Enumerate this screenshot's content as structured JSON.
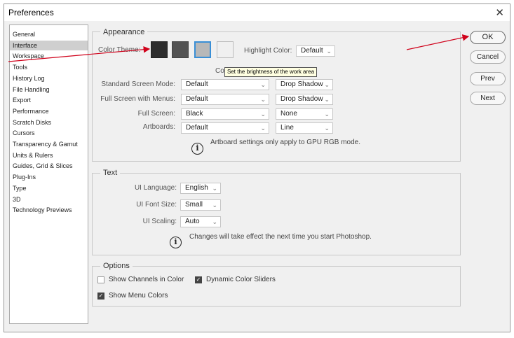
{
  "window": {
    "title": "Preferences",
    "close_glyph": "✕"
  },
  "sidebar": {
    "items": [
      {
        "label": "General"
      },
      {
        "label": "Interface",
        "selected": true
      },
      {
        "label": "Workspace"
      },
      {
        "label": "Tools"
      },
      {
        "label": "History Log"
      },
      {
        "label": "File Handling"
      },
      {
        "label": "Export"
      },
      {
        "label": "Performance"
      },
      {
        "label": "Scratch Disks"
      },
      {
        "label": "Cursors"
      },
      {
        "label": "Transparency & Gamut"
      },
      {
        "label": "Units & Rulers"
      },
      {
        "label": "Guides, Grid & Slices"
      },
      {
        "label": "Plug-Ins"
      },
      {
        "label": "Type"
      },
      {
        "label": "3D"
      },
      {
        "label": "Technology Previews"
      }
    ]
  },
  "appearance": {
    "legend": "Appearance",
    "color_theme_label": "Color Theme:",
    "swatches": [
      {
        "name": "theme-darkest",
        "color": "#2d2d2d"
      },
      {
        "name": "theme-dark",
        "color": "#535353"
      },
      {
        "name": "theme-light",
        "color": "#b8b8b8"
      },
      {
        "name": "theme-lightest",
        "color": "#f0f0f0"
      }
    ],
    "highlight_label": "Highlight Color:",
    "highlight_value": "Default",
    "hidden_label_fragment": "Col",
    "tooltip": "Set the brightness of the work area",
    "rows": [
      {
        "label": "Standard Screen Mode:",
        "mode": "Default",
        "border": "Drop Shadow"
      },
      {
        "label": "Full Screen with Menus:",
        "mode": "Default",
        "border": "Drop Shadow"
      },
      {
        "label": "Full Screen:",
        "mode": "Black",
        "border": "None"
      },
      {
        "label": "Artboards:",
        "mode": "Default",
        "border": "Line"
      }
    ],
    "note": "Artboard settings only apply to GPU RGB mode."
  },
  "text_section": {
    "legend": "Text",
    "ui_language_label": "UI Language:",
    "ui_language": "English",
    "ui_font_size_label": "UI Font Size:",
    "ui_font_size": "Small",
    "ui_scaling_label": "UI Scaling:",
    "ui_scaling": "Auto",
    "note": "Changes will take effect the next time you start Photoshop."
  },
  "options": {
    "legend": "Options",
    "show_channels": {
      "label": "Show Channels in Color",
      "checked": false
    },
    "dynamic_sliders": {
      "label": "Dynamic Color Sliders",
      "checked": true
    },
    "show_menu_colors": {
      "label": "Show Menu Colors",
      "checked": true
    }
  },
  "buttons": {
    "ok": "OK",
    "cancel": "Cancel",
    "prev": "Prev",
    "next": "Next"
  },
  "icons": {
    "chevron": "⌄",
    "info": "i",
    "check": "✓"
  },
  "colors": {
    "annotation_arrow": "#d0021b",
    "selected_theme_border": "#3a8fd6"
  }
}
